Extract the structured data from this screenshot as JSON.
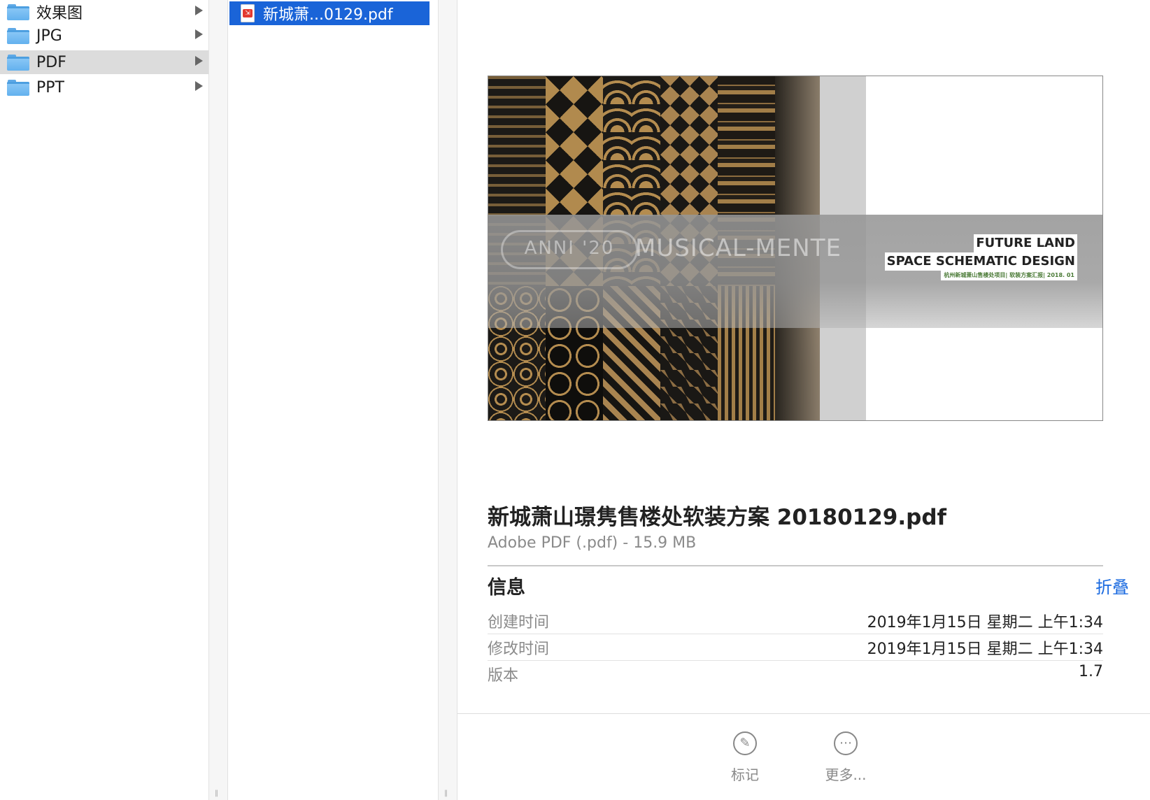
{
  "sidebar": {
    "items": [
      {
        "label": "效果图",
        "selected": false
      },
      {
        "label": "JPG",
        "selected": false
      },
      {
        "label": "PDF",
        "selected": true
      },
      {
        "label": "PPT",
        "selected": false
      }
    ]
  },
  "files": {
    "selected_file": "新城萧...0129.pdf",
    "icon": "pdf-document-icon"
  },
  "preview": {
    "thumbnail": {
      "left_label": "ANNI '20",
      "right_label": "MUSICAL-MENTE",
      "tag1": "FUTURE LAND",
      "tag2": "SPACE SCHEMATIC  DESIGN",
      "tag3": "杭州新城萧山售楼处项目| 软装方案汇报| 2018. 01"
    },
    "title": "新城萧山璟隽售楼处软装方案 20180129.pdf",
    "subtitle": "Adobe PDF (.pdf) - 15.9 MB",
    "info_heading": "信息",
    "collapse_label": "折叠",
    "info_rows": [
      {
        "key": "创建时间",
        "value": "2019年1月15日 星期二 上午1:34"
      },
      {
        "key": "修改时间",
        "value": "2019年1月15日 星期二 上午1:34"
      },
      {
        "key": "版本",
        "value": "1.7"
      }
    ],
    "footer": {
      "markup_label": "标记",
      "more_label": "更多..."
    }
  },
  "colors": {
    "selection_blue": "#1a64d8",
    "link_blue": "#1a6ae0",
    "folder_blue": "#63b1ee"
  }
}
